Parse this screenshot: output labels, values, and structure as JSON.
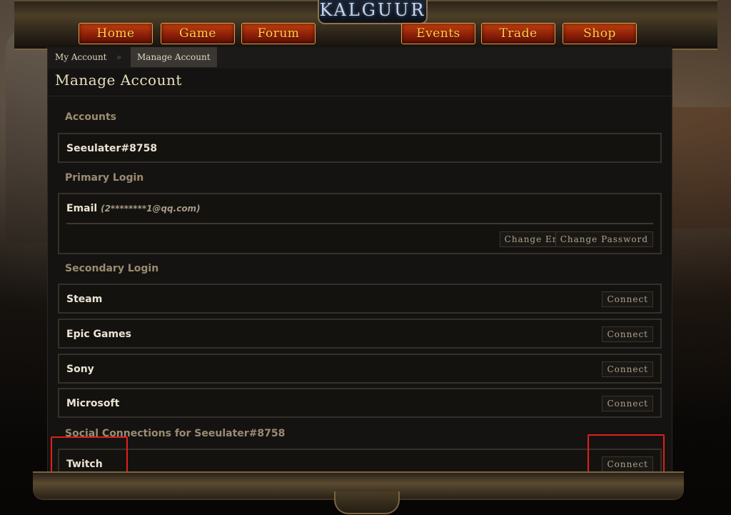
{
  "site": {
    "logo": "KALGUUR",
    "nav": [
      "Home",
      "Game",
      "Forum",
      "Events",
      "Trade",
      "Shop"
    ]
  },
  "breadcrumb": {
    "parent": "My Account",
    "separator": "»",
    "current": "Manage Account"
  },
  "page_title": "Manage Account",
  "sections": {
    "accounts": {
      "label": "Accounts",
      "name": "Seeulater#8758"
    },
    "primary_login": {
      "label": "Primary Login",
      "type": "Email",
      "value": "(2********1@qq.com)",
      "buttons": [
        "Change Email",
        "Change Password"
      ]
    },
    "secondary_login": {
      "label": "Secondary Login",
      "providers": [
        {
          "name": "Steam",
          "action": "Connect"
        },
        {
          "name": "Epic Games",
          "action": "Connect"
        },
        {
          "name": "Sony",
          "action": "Connect"
        },
        {
          "name": "Microsoft",
          "action": "Connect"
        }
      ]
    },
    "social": {
      "label": "Social Connections for Seeulater#8758",
      "providers": [
        {
          "name": "Twitch",
          "action": "Connect"
        }
      ]
    }
  },
  "colors": {
    "nav_button": "#a52d0c",
    "nav_text": "#ffd24a",
    "highlight_box": "#e0201a"
  }
}
